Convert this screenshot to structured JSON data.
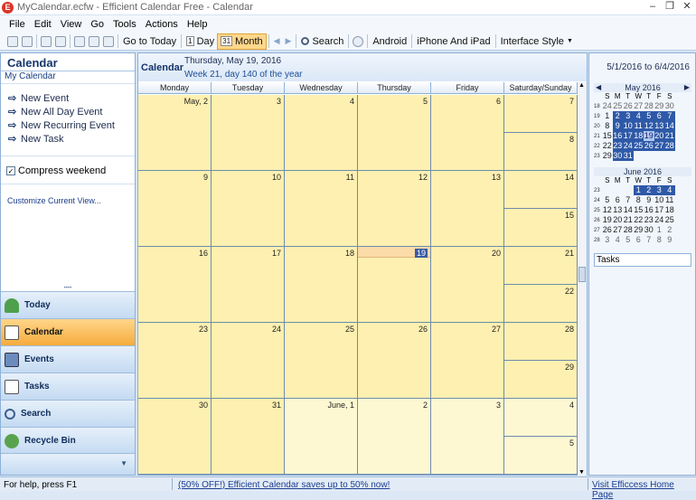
{
  "window": {
    "title": "MyCalendar.ecfw - Efficient Calendar Free - Calendar",
    "app_icon": "E",
    "controls": [
      "–",
      "❐",
      "✕"
    ]
  },
  "menu": [
    {
      "label": "File"
    },
    {
      "label": "Edit"
    },
    {
      "label": "View"
    },
    {
      "label": "Go"
    },
    {
      "label": "Tools"
    },
    {
      "label": "Actions"
    },
    {
      "label": "Help"
    }
  ],
  "toolbar": {
    "go_today": "Go to Today",
    "day_icon": "1",
    "day": "Day",
    "month_icon": "31",
    "month": "Month",
    "prev": "◀",
    "next": "▶",
    "search": "Search",
    "android": "Android",
    "iphone": "iPhone And iPad",
    "interface": "Interface Style"
  },
  "sidebar": {
    "title": "Calendar",
    "subtitle": "My Calendar",
    "tasks": [
      "New Event",
      "New All Day Event",
      "New Recurring Event",
      "New Task"
    ],
    "compress": "Compress weekend",
    "compress_checked": true,
    "customize": "Customize Current View...",
    "nav": [
      {
        "label": "Today",
        "icon": "today-icon",
        "active": false
      },
      {
        "label": "Calendar",
        "icon": "calendar-icon",
        "active": true
      },
      {
        "label": "Events",
        "icon": "events-icon",
        "active": false
      },
      {
        "label": "Tasks",
        "icon": "tasks-icon",
        "active": false
      },
      {
        "label": "Search",
        "icon": "search-icon",
        "active": false
      },
      {
        "label": "Recycle Bin",
        "icon": "recycle-bin-icon",
        "active": false
      }
    ]
  },
  "main": {
    "title": "Calendar",
    "date": "Thursday, May 19, 2016",
    "week": "Week 21, day 140 of the year",
    "range": "5/1/2016 to 6/4/2016",
    "days": [
      "Monday",
      "Tuesday",
      "Wednesday",
      "Thursday",
      "Friday",
      "Saturday/Sunday"
    ],
    "weeks": [
      {
        "mon": "May, 2",
        "tue": "3",
        "wed": "4",
        "thu": "5",
        "fri": "6",
        "sat": "7",
        "sun": "8"
      },
      {
        "mon": "9",
        "tue": "10",
        "wed": "11",
        "thu": "12",
        "fri": "13",
        "sat": "14",
        "sun": "15"
      },
      {
        "mon": "16",
        "tue": "17",
        "wed": "18",
        "thu": "19",
        "fri": "20",
        "sat": "21",
        "sun": "22"
      },
      {
        "mon": "23",
        "tue": "24",
        "wed": "25",
        "thu": "26",
        "fri": "27",
        "sat": "28",
        "sun": "29"
      },
      {
        "mon": "30",
        "tue": "31",
        "wed": "June, 1",
        "thu": "2",
        "fri": "3",
        "sat": "4",
        "sun": "5"
      }
    ]
  },
  "minical_may": {
    "title": "May 2016",
    "dow": [
      "S",
      "M",
      "T",
      "W",
      "T",
      "F",
      "S"
    ],
    "rows": [
      {
        "wk": "18",
        "days": [
          "24",
          "25",
          "26",
          "27",
          "28",
          "29",
          "30"
        ]
      },
      {
        "wk": "19",
        "days": [
          "1",
          "2",
          "3",
          "4",
          "5",
          "6",
          "7"
        ]
      },
      {
        "wk": "20",
        "days": [
          "8",
          "9",
          "10",
          "11",
          "12",
          "13",
          "14"
        ]
      },
      {
        "wk": "21",
        "days": [
          "15",
          "16",
          "17",
          "18",
          "19",
          "20",
          "21"
        ]
      },
      {
        "wk": "22",
        "days": [
          "22",
          "23",
          "24",
          "25",
          "26",
          "27",
          "28"
        ]
      },
      {
        "wk": "23",
        "days": [
          "29",
          "30",
          "31",
          "",
          "",
          "",
          ""
        ]
      }
    ]
  },
  "minical_june": {
    "title": "June 2016",
    "dow": [
      "S",
      "M",
      "T",
      "W",
      "T",
      "F",
      "S"
    ],
    "rows": [
      {
        "wk": "23",
        "days": [
          "",
          "",
          "",
          "1",
          "2",
          "3",
          "4"
        ]
      },
      {
        "wk": "24",
        "days": [
          "5",
          "6",
          "7",
          "8",
          "9",
          "10",
          "11"
        ]
      },
      {
        "wk": "25",
        "days": [
          "12",
          "13",
          "14",
          "15",
          "16",
          "17",
          "18"
        ]
      },
      {
        "wk": "26",
        "days": [
          "19",
          "20",
          "21",
          "22",
          "23",
          "24",
          "25"
        ]
      },
      {
        "wk": "27",
        "days": [
          "26",
          "27",
          "28",
          "29",
          "30",
          "1",
          "2"
        ]
      },
      {
        "wk": "28",
        "days": [
          "3",
          "4",
          "5",
          "6",
          "7",
          "8",
          "9"
        ]
      }
    ]
  },
  "tasks_panel": "Tasks",
  "status": {
    "help": "For help, press F1",
    "promo": "(50% OFF!) Efficient Calendar saves up to 50% now!",
    "home": "Visit Efficcess Home Page"
  }
}
